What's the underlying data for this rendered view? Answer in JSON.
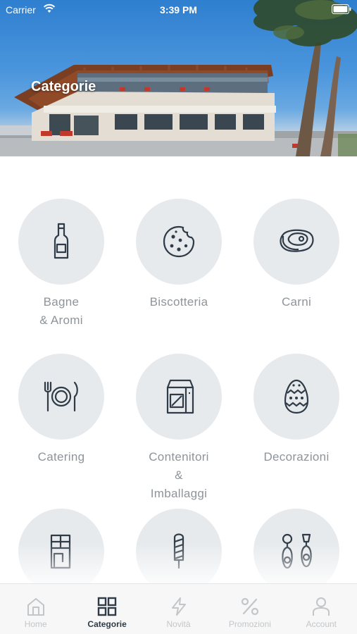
{
  "status_bar": {
    "carrier": "Carrier",
    "time": "3:39 PM",
    "wifi_icon": "wifi-icon",
    "battery_icon": "battery-icon"
  },
  "header": {
    "title": "Categorie"
  },
  "categories": [
    {
      "lines": [
        "Bagne",
        "& Aromi"
      ],
      "icon": "bottle-icon"
    },
    {
      "lines": [
        "Biscotteria"
      ],
      "icon": "cookie-icon"
    },
    {
      "lines": [
        "Carni"
      ],
      "icon": "steak-icon"
    },
    {
      "lines": [
        "Catering"
      ],
      "icon": "plate-cutlery-icon"
    },
    {
      "lines": [
        "Contenitori",
        "&",
        "Imballaggi"
      ],
      "icon": "package-icon"
    },
    {
      "lines": [
        "Decorazioni"
      ],
      "icon": "easter-egg-icon"
    },
    {
      "lines": [],
      "icon": "chocolate-bar-icon"
    },
    {
      "lines": [],
      "icon": "ice-pop-icon"
    },
    {
      "lines": [],
      "icon": "earrings-icon"
    }
  ],
  "tabbar": {
    "active_color": "#2f3b46",
    "inactive_color": "#c3c6c9",
    "items": [
      {
        "label": "Home",
        "icon": "home-icon",
        "active": false
      },
      {
        "label": "Categorie",
        "icon": "grid-icon",
        "active": true
      },
      {
        "label": "Novità",
        "icon": "lightning-icon",
        "active": false
      },
      {
        "label": "Promozioni",
        "icon": "percent-icon",
        "active": false
      },
      {
        "label": "Account",
        "icon": "user-icon",
        "active": false
      }
    ]
  }
}
